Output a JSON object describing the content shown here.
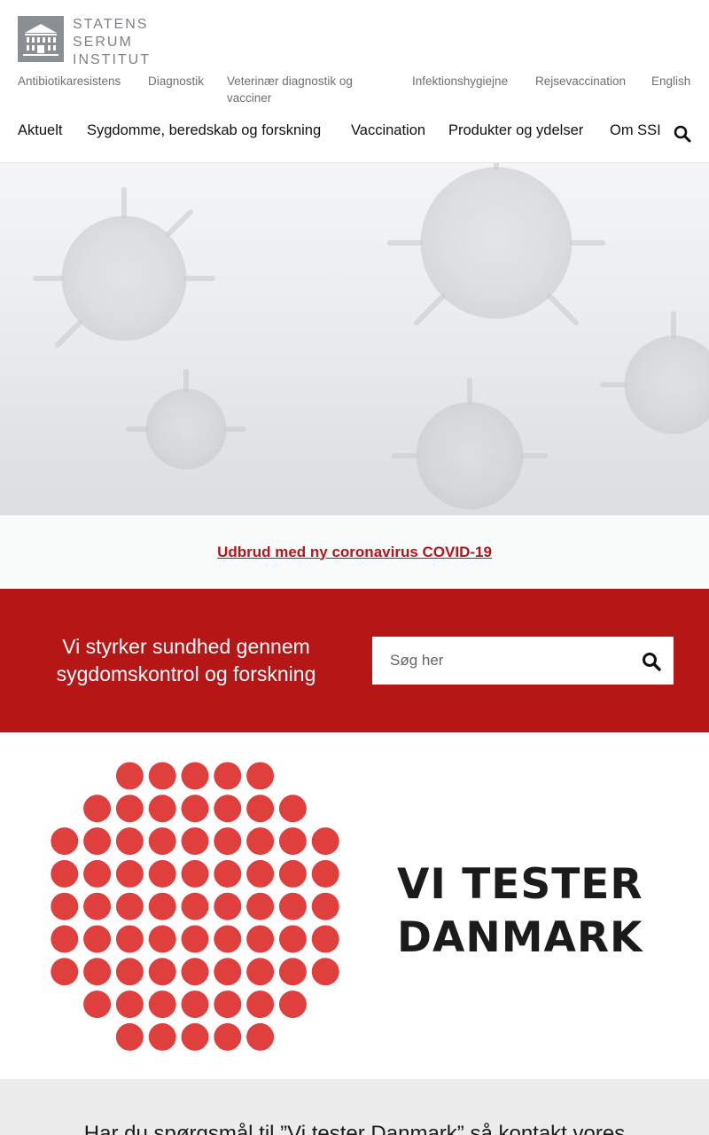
{
  "logo": {
    "line1": "STATENS",
    "line2": "SERUM",
    "line3": "INSTITUT"
  },
  "utility_nav": [
    "Antibiotikaresistens",
    "Diagnostik",
    "Veterinær diagnostik og",
    "vacciner",
    "Infektionshygiejne",
    "Rejsevaccination",
    "English"
  ],
  "main_nav": [
    "Aktuelt",
    "Sygdomme, beredskab og forskning",
    "Vaccination",
    "Produkter og ydelser",
    "Om SSI"
  ],
  "covid_link": "Udbrud med ny coronavirus COVID-19",
  "tagline": "Vi styrker sundhed gennem sygdomskontrol og forskning",
  "search": {
    "placeholder": "Søg her"
  },
  "banner": {
    "line1": "VI TESTER",
    "line2": "DANMARK"
  },
  "bottom_text": "Har du spørgsmål til ”Vi tester Danmark” så kontakt vores",
  "colors": {
    "brand_red": "#b51616",
    "link_red": "#b5151b",
    "dot_red": "#e0403d",
    "logo_grey": "#8a8f94"
  },
  "icons": {
    "search": "search-icon",
    "logo": "institute-building-icon"
  }
}
